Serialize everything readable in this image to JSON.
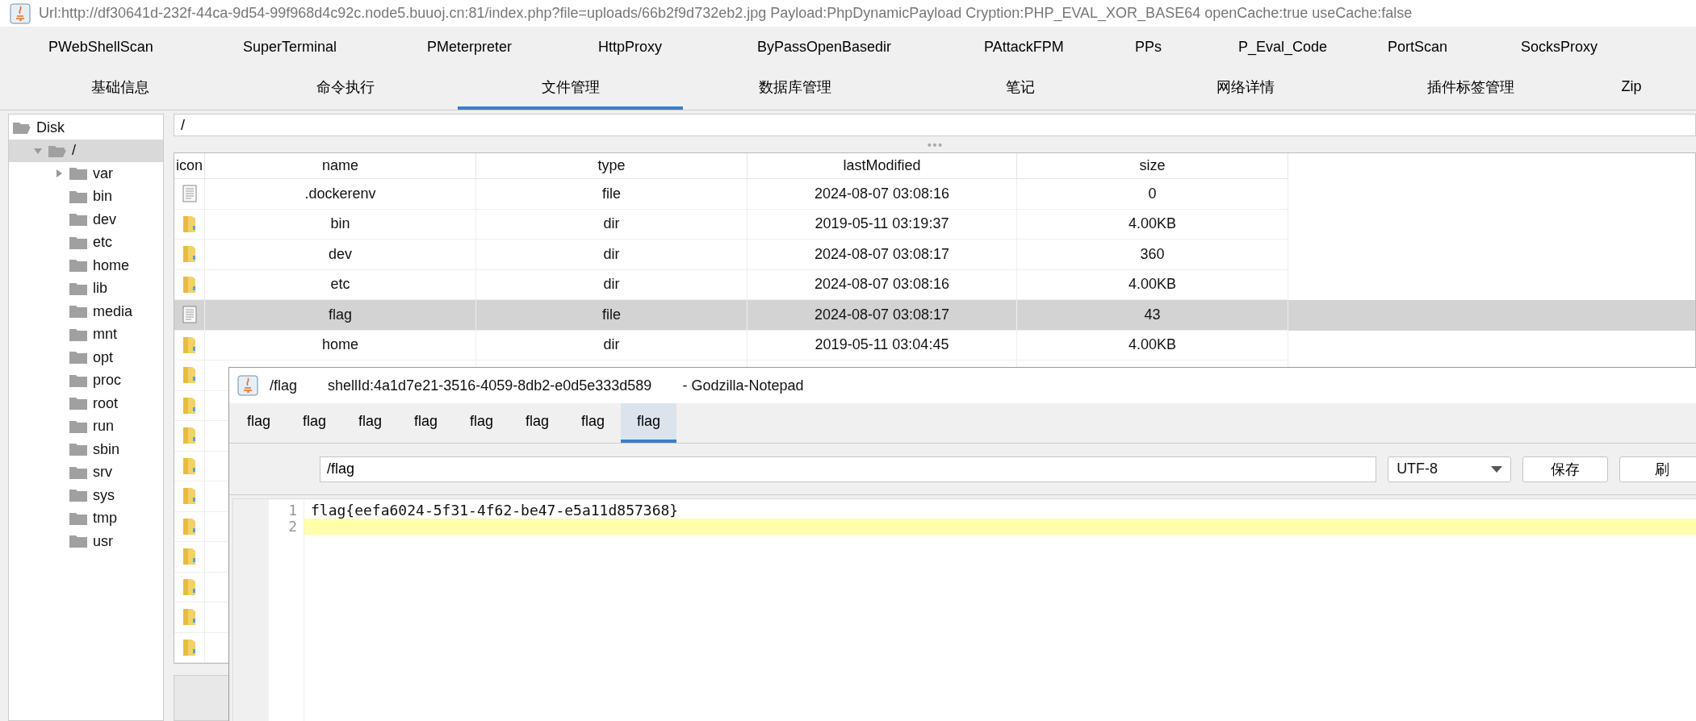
{
  "window": {
    "title": "Url:http://df30641d-232f-44ca-9d54-99f968d4c92c.node5.buuoj.cn:81/index.php?file=uploads/66b2f9d732eb2.jpg Payload:PhpDynamicPayload Cryption:PHP_EVAL_XOR_BASE64 openCache:true useCache:false"
  },
  "plugin_tabs": [
    "PWebShellScan",
    "SuperTerminal",
    "PMeterpreter",
    "HttpProxy",
    "ByPassOpenBasedir",
    "PAttackFPM",
    "PPs",
    "P_Eval_Code",
    "PortScan",
    "SocksProxy"
  ],
  "main_tabs": [
    {
      "label": "基础信息",
      "selected": false
    },
    {
      "label": "命令执行",
      "selected": false
    },
    {
      "label": "文件管理",
      "selected": true
    },
    {
      "label": "数据库管理",
      "selected": false
    },
    {
      "label": "笔记",
      "selected": false
    },
    {
      "label": "网络详情",
      "selected": false
    },
    {
      "label": "插件标签管理",
      "selected": false
    },
    {
      "label": "Zip",
      "selected": false
    }
  ],
  "tree": [
    {
      "label": "Disk",
      "children": [
        {
          "label": "/",
          "expanded": true,
          "selected": true,
          "children": [
            {
              "label": "var",
              "expanded": false
            },
            {
              "label": "bin"
            },
            {
              "label": "dev"
            },
            {
              "label": "etc"
            },
            {
              "label": "home"
            },
            {
              "label": "lib"
            },
            {
              "label": "media"
            },
            {
              "label": "mnt"
            },
            {
              "label": "opt"
            },
            {
              "label": "proc"
            },
            {
              "label": "root"
            },
            {
              "label": "run"
            },
            {
              "label": "sbin"
            },
            {
              "label": "srv"
            },
            {
              "label": "sys"
            },
            {
              "label": "tmp"
            },
            {
              "label": "usr"
            }
          ]
        }
      ]
    }
  ],
  "path_field": {
    "value": "/"
  },
  "table": {
    "columns": [
      "icon",
      "name",
      "type",
      "lastModified",
      "size"
    ],
    "rows": [
      {
        "kind": "file",
        "name": ".dockerenv",
        "type": "file",
        "lastModified": "2024-08-07 03:08:16",
        "size": "0",
        "selected": false
      },
      {
        "kind": "folder",
        "name": "bin",
        "type": "dir",
        "lastModified": "2019-05-11 03:19:37",
        "size": "4.00KB",
        "selected": false
      },
      {
        "kind": "folder",
        "name": "dev",
        "type": "dir",
        "lastModified": "2024-08-07 03:08:17",
        "size": "360",
        "selected": false
      },
      {
        "kind": "folder",
        "name": "etc",
        "type": "dir",
        "lastModified": "2024-08-07 03:08:16",
        "size": "4.00KB",
        "selected": false
      },
      {
        "kind": "file",
        "name": "flag",
        "type": "file",
        "lastModified": "2024-08-07 03:08:17",
        "size": "43",
        "selected": true
      },
      {
        "kind": "folder",
        "name": "home",
        "type": "dir",
        "lastModified": "2019-05-11 03:04:45",
        "size": "4.00KB",
        "selected": false
      },
      {
        "kind": "folder",
        "selected": false
      },
      {
        "kind": "folder",
        "selected": false
      },
      {
        "kind": "folder",
        "selected": false
      },
      {
        "kind": "folder",
        "selected": false
      },
      {
        "kind": "folder",
        "selected": false
      },
      {
        "kind": "folder",
        "selected": false
      },
      {
        "kind": "folder",
        "selected": false
      },
      {
        "kind": "folder",
        "selected": false
      },
      {
        "kind": "folder",
        "selected": false
      },
      {
        "kind": "folder",
        "selected": false
      }
    ]
  },
  "notepad": {
    "title": "/flag",
    "shell_id": "shellId:4a1d7e21-3516-4059-8db2-e0d5e333d589",
    "app": "- Godzilla-Notepad",
    "tabs": [
      {
        "label": "flag",
        "selected": false
      },
      {
        "label": "flag",
        "selected": false
      },
      {
        "label": "flag",
        "selected": false
      },
      {
        "label": "flag",
        "selected": false
      },
      {
        "label": "flag",
        "selected": false
      },
      {
        "label": "flag",
        "selected": false
      },
      {
        "label": "flag",
        "selected": false
      },
      {
        "label": "flag",
        "selected": true
      }
    ],
    "path": "/flag",
    "encoding": "UTF-8",
    "buttons": [
      "保存",
      "刷"
    ],
    "lines": [
      {
        "number": "1",
        "text": "flag{eefa6024-5f31-4f62-be47-e5a11d857368}",
        "current": false
      },
      {
        "number": "2",
        "current": true
      }
    ]
  }
}
